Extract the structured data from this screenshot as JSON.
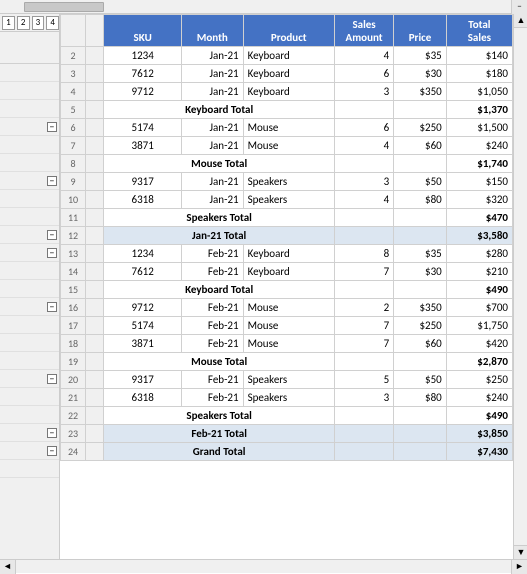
{
  "header": {
    "levels": [
      "1",
      "2",
      "3",
      "4"
    ],
    "scroll_minus": "−"
  },
  "columns": {
    "row_num": "#",
    "a": "",
    "b": "SKU",
    "c": "Month",
    "d": "Product",
    "e_line1": "Sales",
    "e_line2": "Amount",
    "f": "Price",
    "g_line1": "Total",
    "g_line2": "Sales"
  },
  "rows": [
    {
      "row": "2",
      "sku": "1234",
      "month": "Jan-21",
      "product": "Keyboard",
      "sales": "4",
      "price": "$35",
      "total": "$140",
      "type": "data"
    },
    {
      "row": "3",
      "sku": "7612",
      "month": "Jan-21",
      "product": "Keyboard",
      "sales": "6",
      "price": "$30",
      "total": "$180",
      "type": "data"
    },
    {
      "row": "4",
      "sku": "9712",
      "month": "Jan-21",
      "product": "Keyboard",
      "sales": "3",
      "price": "$350",
      "total": "$1,050",
      "type": "data"
    },
    {
      "row": "5",
      "sku": "",
      "month": "",
      "product": "Keyboard Total",
      "sales": "",
      "price": "",
      "total": "$1,370",
      "type": "subtotal"
    },
    {
      "row": "6",
      "sku": "5174",
      "month": "Jan-21",
      "product": "Mouse",
      "sales": "6",
      "price": "$250",
      "total": "$1,500",
      "type": "data"
    },
    {
      "row": "7",
      "sku": "3871",
      "month": "Jan-21",
      "product": "Mouse",
      "sales": "4",
      "price": "$60",
      "total": "$240",
      "type": "data"
    },
    {
      "row": "8",
      "sku": "",
      "month": "",
      "product": "Mouse Total",
      "sales": "",
      "price": "",
      "total": "$1,740",
      "type": "subtotal"
    },
    {
      "row": "9",
      "sku": "9317",
      "month": "Jan-21",
      "product": "Speakers",
      "sales": "3",
      "price": "$50",
      "total": "$150",
      "type": "data"
    },
    {
      "row": "10",
      "sku": "6318",
      "month": "Jan-21",
      "product": "Speakers",
      "sales": "4",
      "price": "$80",
      "total": "$320",
      "type": "data"
    },
    {
      "row": "11",
      "sku": "",
      "month": "",
      "product": "Speakers Total",
      "sales": "",
      "price": "",
      "total": "$470",
      "type": "subtotal"
    },
    {
      "row": "12",
      "sku": "",
      "month": "",
      "product": "Jan-21 Total",
      "sales": "",
      "price": "",
      "total": "$3,580",
      "type": "group-total"
    },
    {
      "row": "13",
      "sku": "1234",
      "month": "Feb-21",
      "product": "Keyboard",
      "sales": "8",
      "price": "$35",
      "total": "$280",
      "type": "data"
    },
    {
      "row": "14",
      "sku": "7612",
      "month": "Feb-21",
      "product": "Keyboard",
      "sales": "7",
      "price": "$30",
      "total": "$210",
      "type": "data"
    },
    {
      "row": "15",
      "sku": "",
      "month": "",
      "product": "Keyboard Total",
      "sales": "",
      "price": "",
      "total": "$490",
      "type": "subtotal"
    },
    {
      "row": "16",
      "sku": "9712",
      "month": "Feb-21",
      "product": "Mouse",
      "sales": "2",
      "price": "$350",
      "total": "$700",
      "type": "data"
    },
    {
      "row": "17",
      "sku": "5174",
      "month": "Feb-21",
      "product": "Mouse",
      "sales": "7",
      "price": "$250",
      "total": "$1,750",
      "type": "data"
    },
    {
      "row": "18",
      "sku": "3871",
      "month": "Feb-21",
      "product": "Mouse",
      "sales": "7",
      "price": "$60",
      "total": "$420",
      "type": "data"
    },
    {
      "row": "19",
      "sku": "",
      "month": "",
      "product": "Mouse Total",
      "sales": "",
      "price": "",
      "total": "$2,870",
      "type": "subtotal"
    },
    {
      "row": "20",
      "sku": "9317",
      "month": "Feb-21",
      "product": "Speakers",
      "sales": "5",
      "price": "$50",
      "total": "$250",
      "type": "data"
    },
    {
      "row": "21",
      "sku": "6318",
      "month": "Feb-21",
      "product": "Speakers",
      "sales": "3",
      "price": "$80",
      "total": "$240",
      "type": "data"
    },
    {
      "row": "22",
      "sku": "",
      "month": "",
      "product": "Speakers Total",
      "sales": "",
      "price": "",
      "total": "$490",
      "type": "subtotal"
    },
    {
      "row": "23",
      "sku": "",
      "month": "",
      "product": "Feb-21 Total",
      "sales": "",
      "price": "",
      "total": "$3,850",
      "type": "group-total"
    },
    {
      "row": "24",
      "sku": "",
      "month": "",
      "product": "Grand Total",
      "sales": "",
      "price": "",
      "total": "$7,430",
      "type": "grand-total"
    }
  ]
}
